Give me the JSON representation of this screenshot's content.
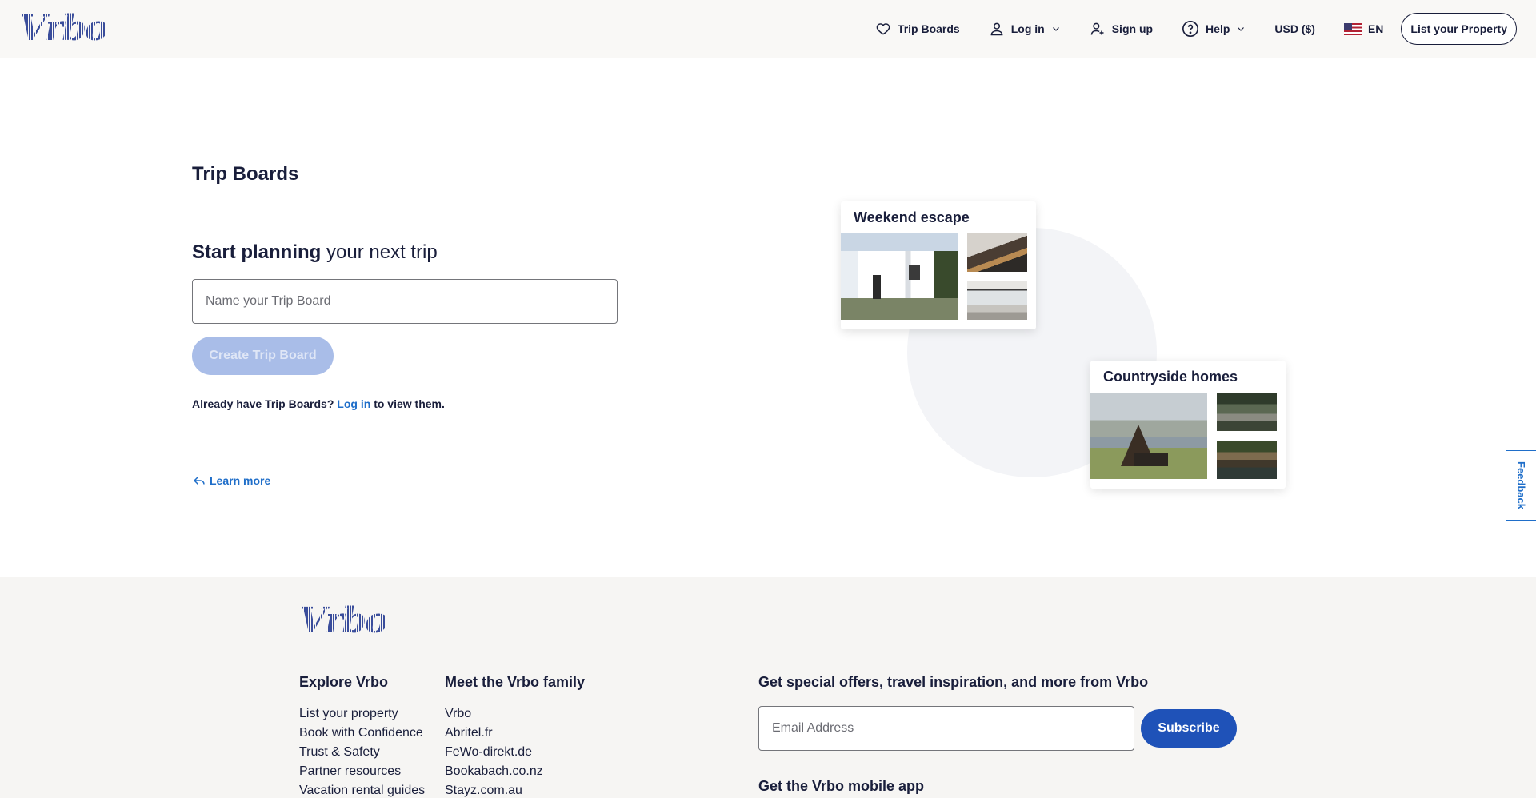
{
  "header": {
    "logo": "Vrbo",
    "nav": {
      "trip_boards": "Trip Boards",
      "log_in": "Log in",
      "sign_up": "Sign up",
      "help": "Help",
      "currency": "USD ($)",
      "language": "EN",
      "list_property": "List your Property"
    },
    "icons": [
      "heart-icon",
      "user-icon",
      "chevron-down-icon",
      "add-user-icon",
      "help-circle-icon",
      "us-flag-icon"
    ]
  },
  "main": {
    "title": "Trip Boards",
    "plan_bold": "Start planning",
    "plan_rest": " your next trip",
    "name_placeholder": "Name your Trip Board",
    "create_button": "Create Trip Board",
    "already_prefix": "Already have Trip Boards?",
    "login_link": "Log in",
    "already_suffix": "to view them.",
    "learn_more": "Learn more",
    "boards": [
      {
        "title": "Weekend escape"
      },
      {
        "title": "Countryside homes"
      }
    ]
  },
  "feedback": "Feedback",
  "footer": {
    "logo": "Vrbo",
    "explore": {
      "heading": "Explore Vrbo",
      "items": [
        "List your property",
        "Book with Confidence",
        "Trust & Safety",
        "Partner resources",
        "Vacation rental guides"
      ]
    },
    "family": {
      "heading": "Meet the Vrbo family",
      "items": [
        "Vrbo",
        "Abritel.fr",
        "FeWo-direkt.de",
        "Bookabach.co.nz",
        "Stayz.com.au"
      ]
    },
    "newsletter": {
      "heading": "Get special offers, travel inspiration, and more from Vrbo",
      "email_placeholder": "Email Address",
      "subscribe": "Subscribe"
    },
    "app_heading": "Get the Vrbo mobile app"
  },
  "colors": {
    "brand_blue": "#1f52b8",
    "link_blue": "#1f6ec9",
    "disabled_button": "#a9bde8",
    "text_dark": "#191e3b"
  }
}
